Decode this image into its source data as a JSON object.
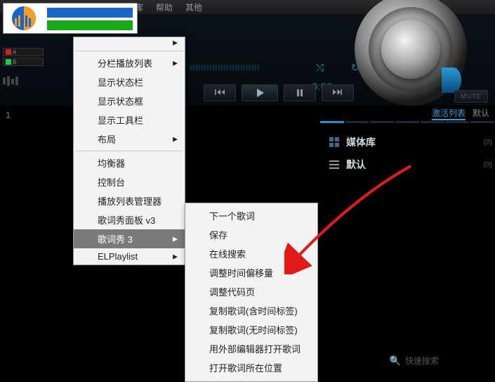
{
  "topmenu": {
    "item1": "体库",
    "item2": "帮助",
    "item3": "其他"
  },
  "logo": {
    "bar1_color": "#1766c7",
    "bar2_color": "#18a818"
  },
  "time": "0:00",
  "controls": {
    "shuffle_glyph": "⤭",
    "repeat_glyph": "↻"
  },
  "mute_label": "MUTE",
  "tracknum": "1",
  "rtabs": {
    "active": "激活列表",
    "default": "默认"
  },
  "rlist": {
    "media_library": "媒体库",
    "default": "默认",
    "count0": "(0)",
    "count1": "(0)"
  },
  "menu1": {
    "items": [
      {
        "label": "",
        "arrow": true
      },
      {
        "sep": true
      },
      {
        "label": "分栏播放列表",
        "arrow": true
      },
      {
        "label": "显示状态栏"
      },
      {
        "label": "显示状态框"
      },
      {
        "label": "显示工具栏"
      },
      {
        "label": "布局",
        "arrow": true
      },
      {
        "sep": true
      },
      {
        "label": "均衡器"
      },
      {
        "label": "控制台"
      },
      {
        "label": "播放列表管理器"
      },
      {
        "label": "歌词秀面板 v3"
      },
      {
        "label": "歌词秀 3",
        "arrow": true,
        "selected": true
      },
      {
        "label": "ELPlaylist",
        "arrow": true
      }
    ]
  },
  "menu2": {
    "items": [
      {
        "label": "下一个歌词"
      },
      {
        "label": "保存"
      },
      {
        "label": "在线搜索"
      },
      {
        "label": "调整时间偏移量"
      },
      {
        "label": "调整代码页"
      },
      {
        "label": "复制歌词(含时间标签)"
      },
      {
        "label": "复制歌词(无时间标签)"
      },
      {
        "label": "用外部编辑器打开歌词"
      },
      {
        "label": "打开歌词所在位置"
      }
    ]
  },
  "quicksearch": {
    "label": "快速搜索"
  }
}
